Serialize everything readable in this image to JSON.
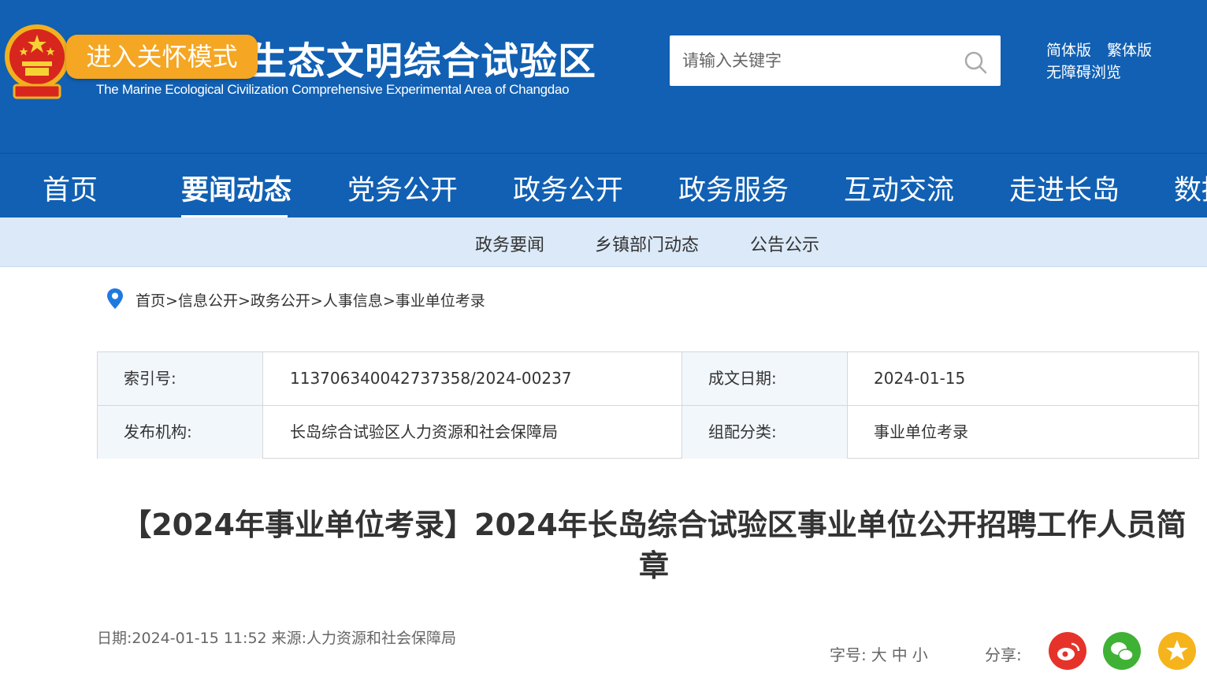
{
  "header": {
    "site_title": "长岛海洋生态文明综合试验区",
    "site_subtitle": "The Marine Ecological Civilization Comprehensive Experimental Area of Changdao",
    "care_mode_button": "进入关怀模式",
    "search": {
      "placeholder": "请输入关键字"
    },
    "lang_simplified": "简体版",
    "lang_traditional": "繁体版",
    "accessible": "无障碍浏览"
  },
  "nav": {
    "items": [
      "首页",
      "要闻动态",
      "党务公开",
      "政务公开",
      "政务服务",
      "互动交流",
      "走进长岛",
      "数据开放"
    ],
    "active_index": 1
  },
  "subnav": {
    "items": [
      "政务要闻",
      "乡镇部门动态",
      "公告公示"
    ]
  },
  "breadcrumb": {
    "items": [
      "首页",
      "信息公开",
      "政务公开",
      "人事信息",
      "事业单位考录"
    ],
    "separator": ">"
  },
  "info": {
    "index_label": "索引号:",
    "index_value": "113706340042737358/2024-00237",
    "date_label": "成文日期:",
    "date_value": "2024-01-15",
    "publisher_label": "发布机构:",
    "publisher_value": "长岛综合试验区人力资源和社会保障局",
    "category_label": "组配分类:",
    "category_value": "事业单位考录"
  },
  "article": {
    "title": "【2024年事业单位考录】2024年长岛综合试验区事业单位公开招聘工作人员简章",
    "meta": "日期:2024-01-15 11:52 来源:人力资源和社会保障局",
    "font_size_label": "字号:",
    "font_sizes": [
      "大",
      "中",
      "小"
    ],
    "share_label": "分享:"
  },
  "colors": {
    "primary_blue": "#1160b3",
    "subnav_bg": "#dbe9f8",
    "care_button": "#f5a623",
    "weibo": "#e6332a",
    "wechat": "#3fb235",
    "qzone": "#f5b41b"
  }
}
